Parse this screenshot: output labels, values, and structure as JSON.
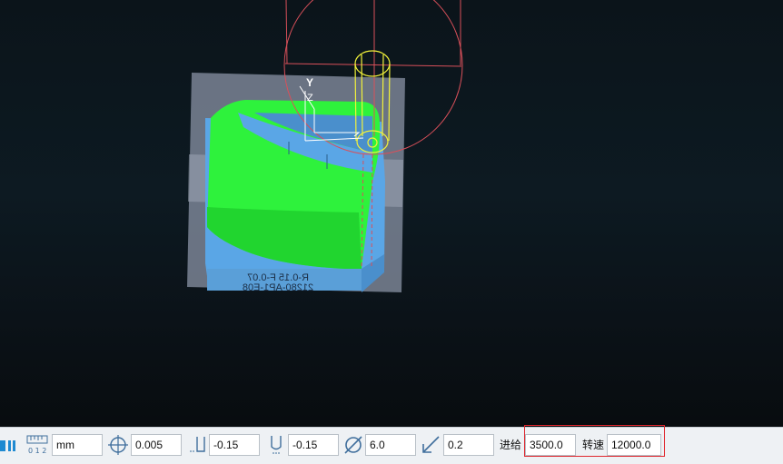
{
  "viewport": {
    "axis_label": "Y",
    "z_label": "Z",
    "part_text_line1": "R-0.15 F-0.07",
    "part_text_line2": "21280-AP1-E08",
    "colors": {
      "machined_surface": "#2ef23c",
      "stock": "#5aa6e6",
      "fixture": "#8a93a5",
      "tool_outline": "#f2f23a",
      "holder_outline": "#d9505a"
    }
  },
  "toolbar": {
    "unit_value": "mm",
    "tolerance_value": "0.005",
    "side_stock_value": "-0.15",
    "bottom_stock_value": "-0.15",
    "tool_diameter_value": "6.0",
    "step_value": "0.2",
    "feed_label": "进给",
    "feed_value": "3500.0",
    "speed_label": "转速",
    "speed_value": "12000.0"
  }
}
